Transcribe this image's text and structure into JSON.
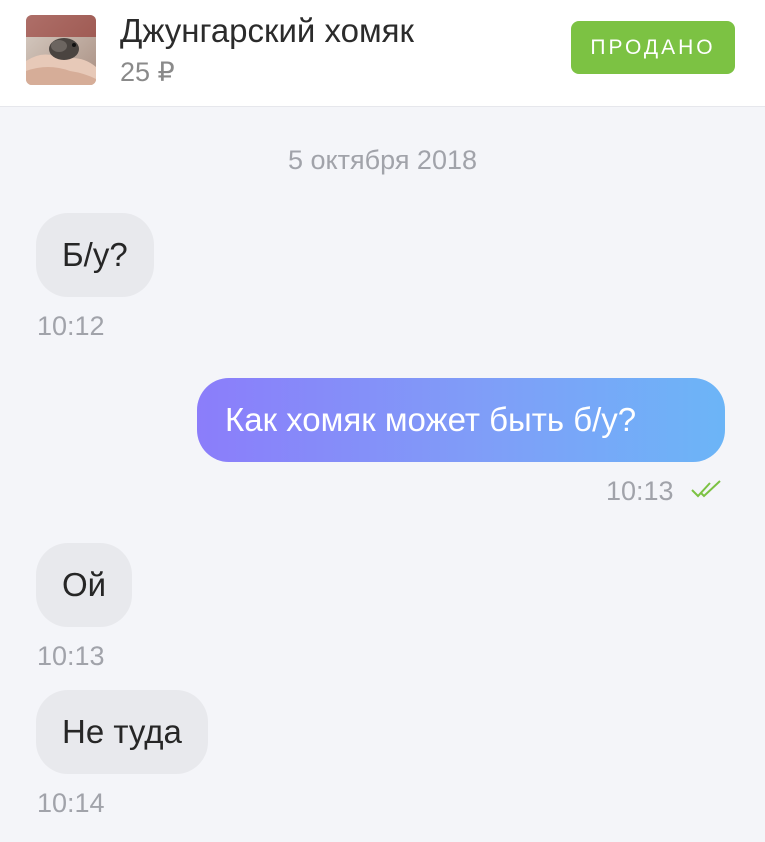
{
  "header": {
    "product_title": "Джунгарский хомяк",
    "price": "25 ₽",
    "status_badge": "ПРОДАНО",
    "badge_color": "#7cc243"
  },
  "chat": {
    "date": "5 октября 2018",
    "messages": [
      {
        "direction": "incoming",
        "text": "Б/у?",
        "time": "10:12"
      },
      {
        "direction": "outgoing",
        "text": "Как хомяк может быть б/у?",
        "time": "10:13",
        "status_icon": "double-check-icon",
        "status_color": "#7cc243"
      },
      {
        "direction": "incoming",
        "text": "Ой",
        "time": "10:13"
      },
      {
        "direction": "incoming",
        "text": "Не туда",
        "time": "10:14"
      }
    ]
  },
  "colors": {
    "incoming_bubble": "#e8e9ed",
    "outgoing_gradient_start": "#8b7dfa",
    "outgoing_gradient_end": "#6cb5f7",
    "background": "#f4f5f9"
  }
}
